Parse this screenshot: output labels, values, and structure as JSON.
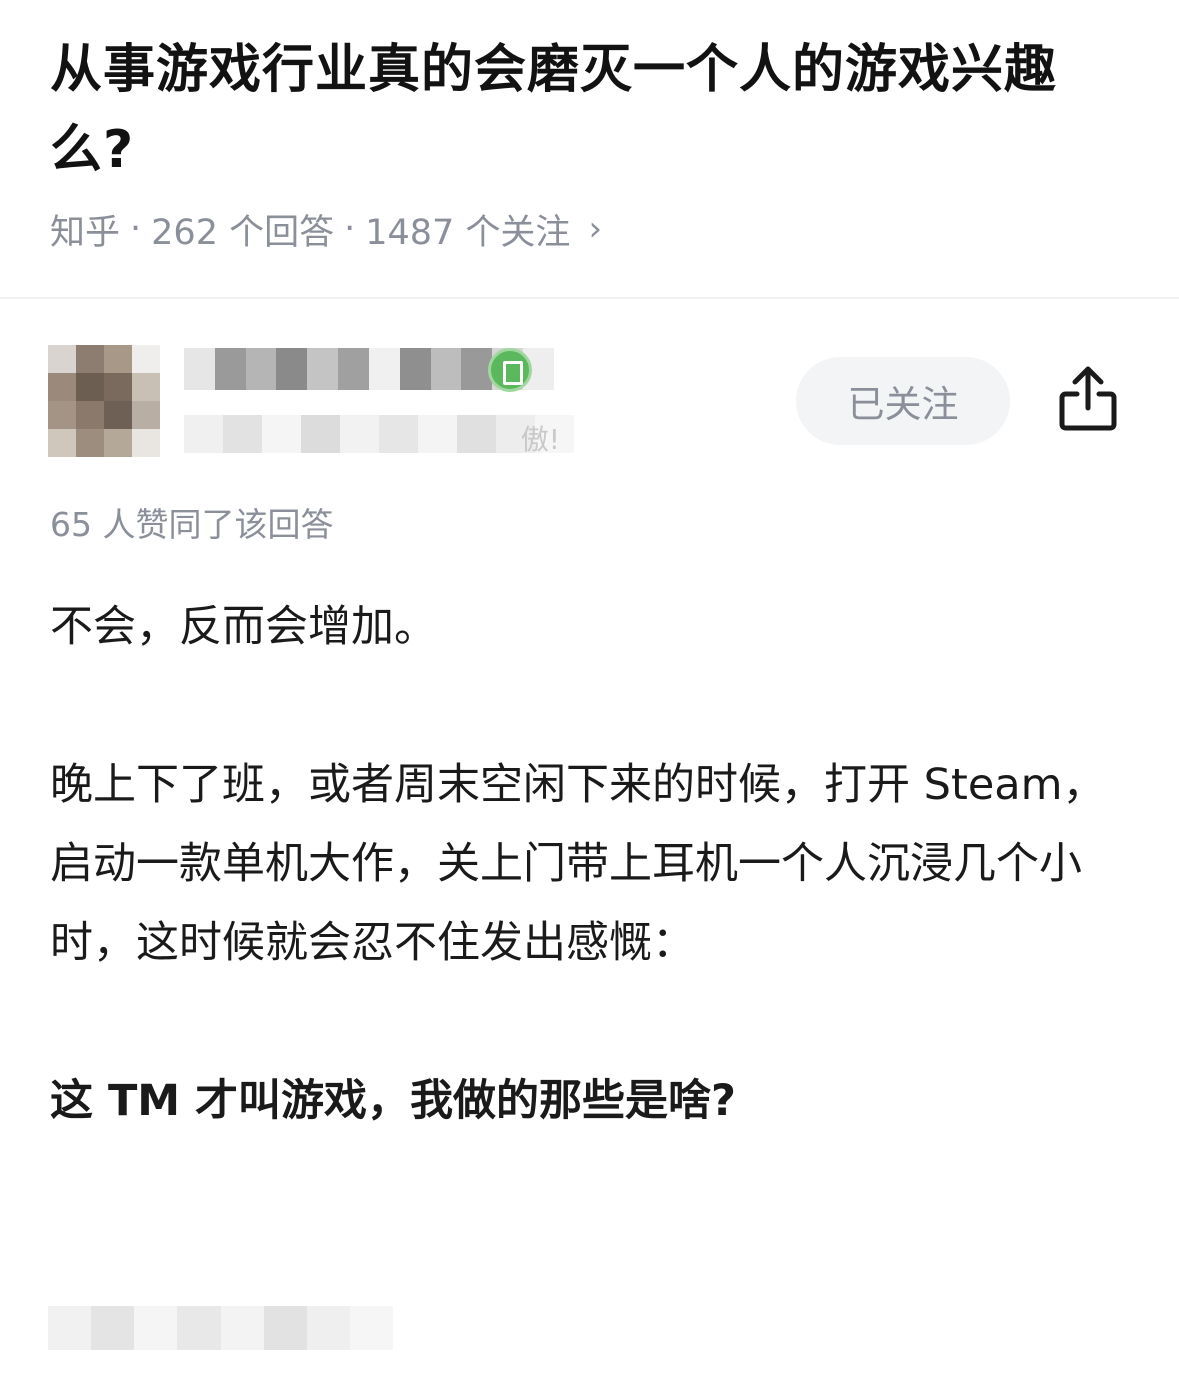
{
  "question": {
    "title": "从事游戏行业真的会磨灭一个人的游戏兴趣么?",
    "source": "知乎",
    "separator": "·",
    "answers_count": "262 个回答",
    "followers_count": "1487 个关注",
    "chevron_glyph": "›"
  },
  "author": {
    "avatar": "pixelated-avatar",
    "name_hidden": true,
    "bio_tail": "傲!",
    "follow_label": "已关注",
    "share_icon": "share-icon"
  },
  "answer": {
    "upvote_text": "65 人赞同了该回答",
    "paragraphs": [
      "不会，反而会增加。",
      "晚上下了班，或者周末空闲下来的时候，打开 Steam，启动一款单机大作，关上门带上耳机一个人沉浸几个小时，这时候就会忍不住发出感慨：",
      "这 TM 才叫游戏，我做的那些是啥?"
    ]
  },
  "colors": {
    "muted": "#8a8f99",
    "follow_bg": "#f3f4f6",
    "badge_green": "#5cb85c"
  }
}
